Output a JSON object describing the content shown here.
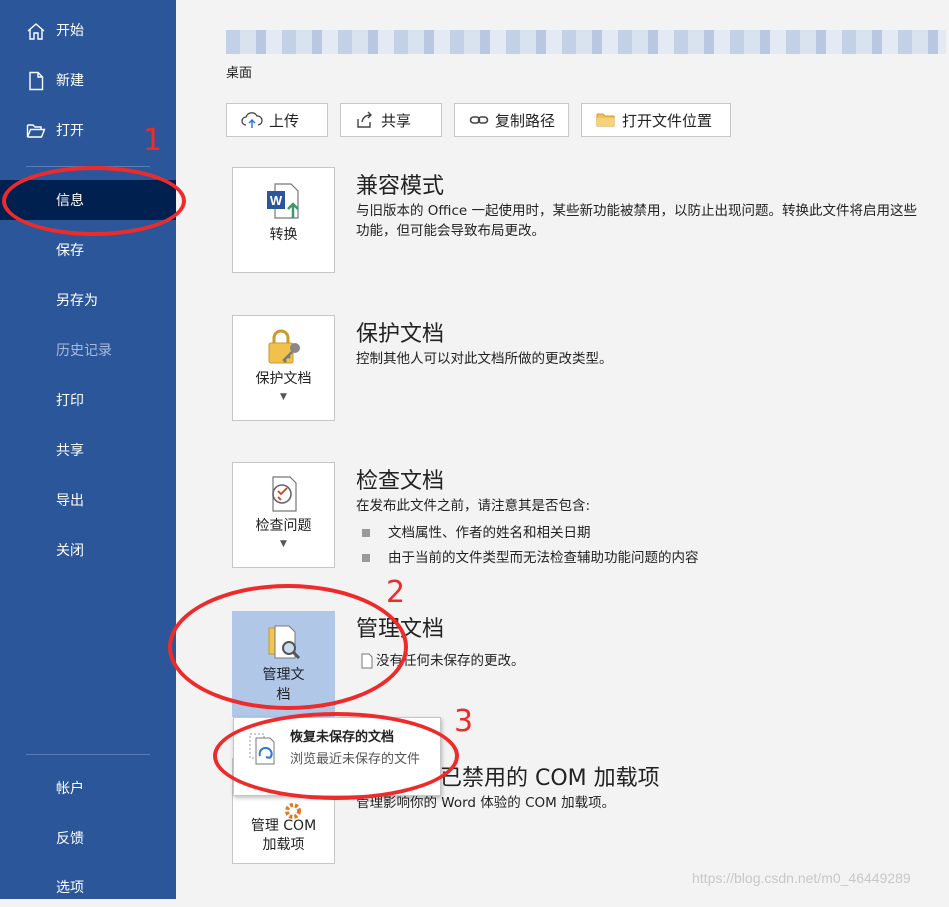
{
  "sidebar": {
    "items": [
      {
        "label": "开始",
        "icon": "home-icon"
      },
      {
        "label": "新建",
        "icon": "new-document-icon"
      },
      {
        "label": "打开",
        "icon": "folder-open-icon"
      },
      {
        "label": "信息",
        "active": true
      },
      {
        "label": "保存"
      },
      {
        "label": "另存为"
      },
      {
        "label": "历史记录",
        "disabled": true
      },
      {
        "label": "打印"
      },
      {
        "label": "共享"
      },
      {
        "label": "导出"
      },
      {
        "label": "关闭"
      },
      {
        "label": "帐户"
      },
      {
        "label": "反馈"
      },
      {
        "label": "选项"
      }
    ],
    "colors": {
      "background": "#2b579a",
      "active": "#002050"
    }
  },
  "header": {
    "path": "桌面"
  },
  "toolbar": {
    "upload": "上传",
    "share": "共享",
    "copy_path": "复制路径",
    "open_location": "打开文件位置"
  },
  "sections": {
    "compat": {
      "button": "转换",
      "title": "兼容模式",
      "desc": "与旧版本的 Office 一起使用时，某些新功能被禁用，以防止出现问题。转换此文件将启用这些功能，但可能会导致布局更改。"
    },
    "protect": {
      "button": "保护文档",
      "title": "保护文档",
      "desc": "控制其他人可以对此文档所做的更改类型。"
    },
    "inspect": {
      "button": "检查问题",
      "title": "检查文档",
      "desc": "在发布此文件之前，请注意其是否包含:",
      "bullets": [
        "文档属性、作者的姓名和相关日期",
        "由于当前的文件类型而无法检查辅助功能问题的内容"
      ]
    },
    "manage": {
      "button_line1": "管理文",
      "button_line2": "档",
      "title": "管理文档",
      "desc": "没有任何未保存的更改。"
    },
    "com": {
      "button_line1": "管理 COM",
      "button_line2": "加载项",
      "title": "已禁用的 COM 加载项",
      "desc": "管理影响你的 Word 体验的 COM 加载项。"
    }
  },
  "dropdown": {
    "title": "恢复未保存的文档",
    "desc": "浏览最近未保存的文件"
  },
  "annotations": {
    "one": "1",
    "two": "2",
    "three": "3",
    "color": "#ee2b2b"
  },
  "watermark": "https://blog.csdn.net/m0_46449289"
}
